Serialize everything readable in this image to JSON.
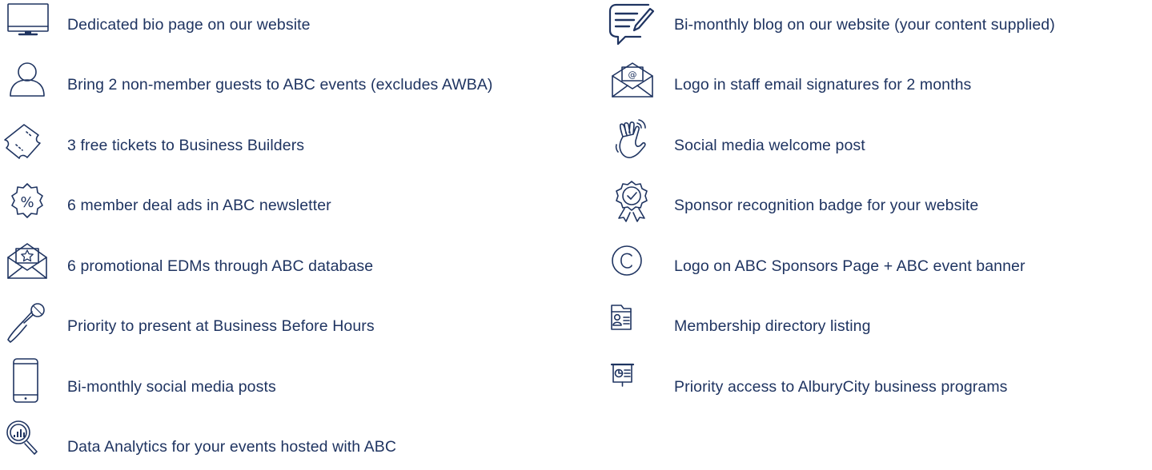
{
  "colors": {
    "text": "#1f3461",
    "icon": "#1f3461",
    "background": "#ffffff"
  },
  "left": [
    {
      "icon": "monitor-icon",
      "label": "Dedicated bio page on our website"
    },
    {
      "icon": "person-icon",
      "label": "Bring 2 non-member guests to ABC events (excludes AWBA)"
    },
    {
      "icon": "ticket-icon",
      "label": "3 free tickets to Business Builders"
    },
    {
      "icon": "discount-badge-icon",
      "label": "6 member deal ads in ABC newsletter"
    },
    {
      "icon": "envelope-star-icon",
      "label": "6 promotional EDMs through ABC database"
    },
    {
      "icon": "microphone-icon",
      "label": "Priority to present at Business Before Hours"
    },
    {
      "icon": "smartphone-icon",
      "label": "Bi-monthly social media posts"
    },
    {
      "icon": "analytics-magnifier-icon",
      "label": "Data Analytics for your events hosted with ABC"
    }
  ],
  "right": [
    {
      "icon": "document-pen-icon",
      "label": "Bi-monthly blog on our website (your content supplied)"
    },
    {
      "icon": "email-at-icon",
      "label": "Logo in staff email signatures for 2 months"
    },
    {
      "icon": "waving-hand-icon",
      "label": "Social media welcome post"
    },
    {
      "icon": "award-badge-icon",
      "label": "Sponsor recognition badge for your website"
    },
    {
      "icon": "copyright-icon",
      "label": "Logo on ABC Sponsors Page + ABC event banner"
    },
    {
      "icon": "directory-folder-icon",
      "label": "Membership directory listing"
    },
    {
      "icon": "presentation-board-icon",
      "label": "Priority access to AlburyCity business programs"
    }
  ]
}
